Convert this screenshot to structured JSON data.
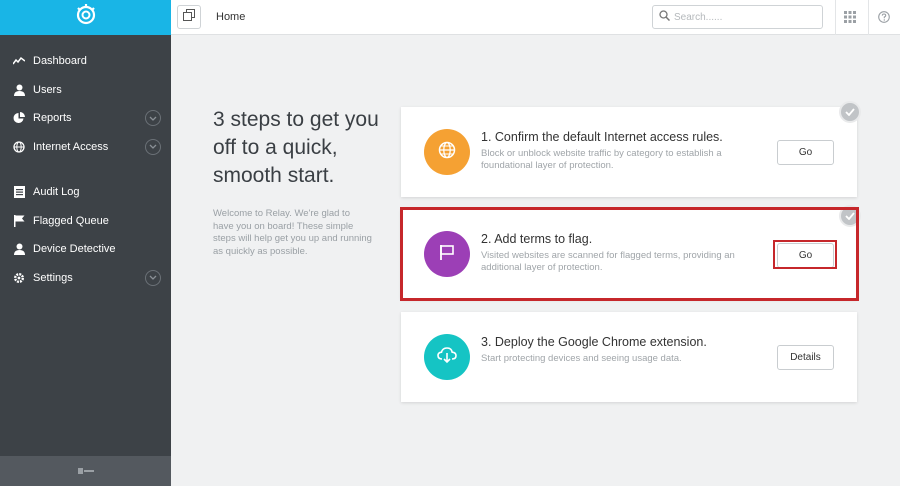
{
  "sidebar": {
    "items": [
      {
        "label": "Dashboard",
        "icon": "activity-icon",
        "expandable": false
      },
      {
        "label": "Users",
        "icon": "user-icon",
        "expandable": false
      },
      {
        "label": "Reports",
        "icon": "pie-chart-icon",
        "expandable": true
      },
      {
        "label": "Internet Access",
        "icon": "globe-icon",
        "expandable": true
      },
      {
        "label": "Audit Log",
        "icon": "list-icon",
        "expandable": false
      },
      {
        "label": "Flagged Queue",
        "icon": "flag-icon",
        "expandable": false
      },
      {
        "label": "Device Detective",
        "icon": "user-icon",
        "expandable": false
      },
      {
        "label": "Settings",
        "icon": "gear-icon",
        "expandable": true
      }
    ]
  },
  "topbar": {
    "breadcrumb": "Home",
    "search_placeholder": "Search......"
  },
  "intro": {
    "title": "3 steps to get you off to a quick, smooth start.",
    "text": "Welcome to Relay. We're glad to have you on board! These simple steps will help get you up and running as quickly as possible."
  },
  "steps": [
    {
      "title": "1. Confirm the default Internet access rules.",
      "description": "Block or unblock website traffic by category to establish a foundational layer of protection.",
      "button": "Go",
      "color": "#f5a133"
    },
    {
      "title": "2. Add terms to flag.",
      "description": "Visited websites are scanned for flagged terms, providing an additional layer of protection.",
      "button": "Go",
      "color": "#9c3fb6"
    },
    {
      "title": "3. Deploy the Google Chrome extension.",
      "description": "Start protecting devices and seeing usage data.",
      "button": "Details",
      "color": "#15c4c4"
    }
  ],
  "colors": {
    "sidebar": "#3d4247",
    "brand": "#19b5e6",
    "highlight": "#c6272b"
  }
}
